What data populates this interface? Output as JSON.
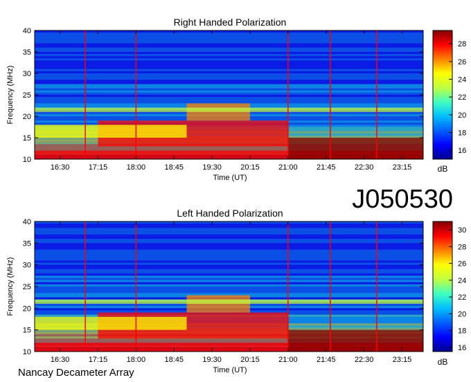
{
  "date_code": "J050530",
  "footer": "Nancay Decameter Array",
  "colors": {
    "colormap": [
      "#00008f",
      "#0000ff",
      "#0060ff",
      "#00c0ff",
      "#40ffc0",
      "#c0ff40",
      "#ffff00",
      "#ff8000",
      "#ff0000",
      "#800000"
    ],
    "background_base": "#1a3cc8"
  },
  "chart_data": [
    {
      "type": "heatmap",
      "title": "Right Handed Polarization",
      "xlabel": "Time (UT)",
      "ylabel": "Frequency (MHz)",
      "xticks": [
        "16:30",
        "17:15",
        "18:00",
        "18:45",
        "19:30",
        "20:15",
        "21:00",
        "21:45",
        "22:30",
        "23:15"
      ],
      "yticks": [
        10,
        15,
        20,
        25,
        30,
        35,
        40
      ],
      "ylim": [
        10,
        40
      ],
      "colorbar": {
        "label": "dB",
        "ticks": [
          16,
          18,
          20,
          22,
          24,
          26,
          28
        ],
        "range": [
          15,
          29.5
        ]
      }
    },
    {
      "type": "heatmap",
      "title": "Left Handed Polarization",
      "xlabel": "Time (UT)",
      "ylabel": "Frequency (MHz)",
      "xticks": [
        "16:30",
        "17:15",
        "18:00",
        "18:45",
        "19:30",
        "20:15",
        "21:00",
        "21:45",
        "22:30",
        "23:15"
      ],
      "yticks": [
        10,
        15,
        20,
        25,
        30,
        35,
        40
      ],
      "ylim": [
        10,
        40
      ],
      "colorbar": {
        "label": "dB",
        "ticks": [
          16,
          18,
          20,
          22,
          24,
          26,
          28,
          30
        ],
        "range": [
          15.5,
          31
        ]
      }
    }
  ]
}
